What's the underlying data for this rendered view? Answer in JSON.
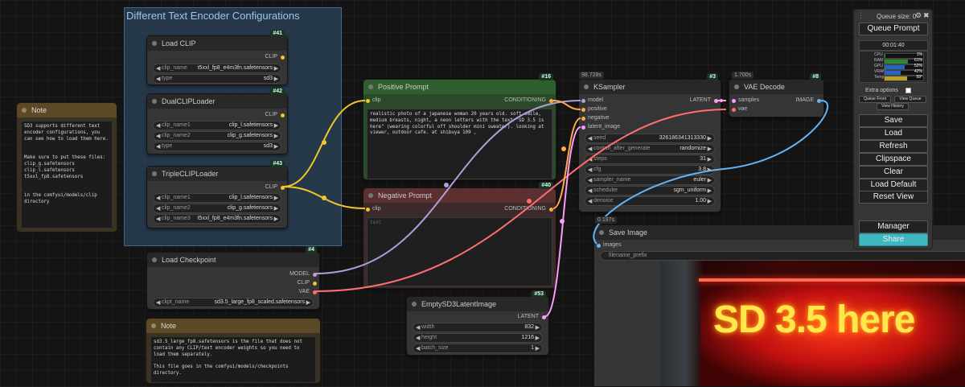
{
  "group": {
    "title": "Different Text Encoder Configurations"
  },
  "nodes": {
    "load_clip": {
      "title": "Load CLIP",
      "id": "#41",
      "output": "CLIP",
      "widgets": [
        {
          "label": "clip_name",
          "value": "t5xxl_fp8_e4m3fn.safetensors"
        },
        {
          "label": "type",
          "value": "sd3"
        }
      ]
    },
    "dual_clip": {
      "title": "DualCLIPLoader",
      "id": "#42",
      "output": "CLIP",
      "widgets": [
        {
          "label": "clip_name1",
          "value": "clip_l.safetensors"
        },
        {
          "label": "clip_name2",
          "value": "clip_g.safetensors"
        },
        {
          "label": "type",
          "value": "sd3"
        }
      ]
    },
    "triple_clip": {
      "title": "TripleCLIPLoader",
      "id": "#43",
      "output": "CLIP",
      "widgets": [
        {
          "label": "clip_name1",
          "value": "clip_l.safetensors"
        },
        {
          "label": "clip_name2",
          "value": "clip_g.safetensors"
        },
        {
          "label": "clip_name3",
          "value": "t5xxl_fp8_e4m3fn.safetensors"
        }
      ]
    },
    "load_checkpoint": {
      "title": "Load Checkpoint",
      "id": "#4",
      "outputs": [
        "MODEL",
        "CLIP",
        "VAE"
      ],
      "widgets": [
        {
          "label": "ckpt_name",
          "value": "sd3.5_large_fp8_scaled.safetensors"
        }
      ]
    },
    "positive": {
      "title": "Positive Prompt",
      "id": "#16",
      "input": "clip",
      "output": "CONDITIONING",
      "text": "realistic photo of a japanese woman 20 years old. soft smile, medium breasts, night, a neon letters with the text \"SD 3.5 is here\" (wearing colorful off shoulder mini sweater). looking at viewer, outdoor cafe. at shibuya 109 ,"
    },
    "negative": {
      "title": "Negative Prompt",
      "id": "#40",
      "input": "clip",
      "output": "CONDITIONING",
      "placeholder": "text"
    },
    "empty_latent": {
      "title": "EmptySD3LatentImage",
      "id": "#53",
      "output": "LATENT",
      "widgets": [
        {
          "label": "width",
          "value": "832"
        },
        {
          "label": "height",
          "value": "1216"
        },
        {
          "label": "batch_size",
          "value": "1"
        }
      ]
    },
    "ksampler": {
      "title": "KSampler",
      "id": "#3",
      "timing": "98.728s",
      "inputs": [
        "model",
        "positive",
        "negative",
        "latent_image"
      ],
      "output": "LATENT",
      "widgets": [
        {
          "label": "seed",
          "value": "326186341313330"
        },
        {
          "label": "control_after_generate",
          "value": "randomize"
        },
        {
          "label": "steps",
          "value": "31"
        },
        {
          "label": "cfg",
          "value": "3.8"
        },
        {
          "label": "sampler_name",
          "value": "euler"
        },
        {
          "label": "scheduler",
          "value": "sgm_uniform"
        },
        {
          "label": "denoise",
          "value": "1.00"
        }
      ]
    },
    "vae_decode": {
      "title": "VAE Decode",
      "id": "#8",
      "timing": "1.700s",
      "inputs": [
        "samples",
        "vae"
      ],
      "output": "IMAGE"
    },
    "save_image": {
      "title": "Save Image",
      "timing": "0.197s",
      "input": "images",
      "widget_label": "filename_prefix"
    }
  },
  "notes": {
    "note1": {
      "title": "Note",
      "text": "SD3 supports different text encoder configurations, you can see how to load them here.\n\n\nMake sure to put these files:\nclip_g.safetensors\nclip_l.safetensors\nt5xxl_fp8.safetensors\n\n\nin the comfyui/models/clip directory"
    },
    "note2": {
      "title": "Note",
      "text": "sd3.5_large_fp8.safetensors is the file that does not contain any CLIP/text encoder weights so you need to load them separately.\n\nThis file goes in the comfyui/models/checkpoints directory."
    }
  },
  "preview": {
    "sign_text": "SD 3.5 here"
  },
  "panel": {
    "queue_size": "Queue size: 0",
    "queue_prompt": "Queue Prompt",
    "timer": "00:01:40",
    "stats": [
      {
        "label": "CPU",
        "value": "1%",
        "fraction": 0.01,
        "color": "#2a8a2a"
      },
      {
        "label": "RAM",
        "value": "61%",
        "fraction": 0.61,
        "color": "#2a8a2a"
      },
      {
        "label": "GPU",
        "value": "52%",
        "fraction": 0.52,
        "color": "#2563c9"
      },
      {
        "label": "VRAM",
        "value": "42%",
        "fraction": 0.42,
        "color": "#2563c9"
      },
      {
        "label": "Temp",
        "value": "59°",
        "fraction": 0.59,
        "color": "#b8a020"
      }
    ],
    "extra_options": "Extra options",
    "queue_front": "Queue Front",
    "view_queue": "View Queue",
    "view_history": "View History",
    "buttons": [
      "Save",
      "Load",
      "Refresh",
      "Clipspace",
      "Clear",
      "Load Default",
      "Reset View"
    ],
    "manager": "Manager",
    "share": "Share",
    "colors": {
      "share": "#3fb7c0"
    }
  }
}
